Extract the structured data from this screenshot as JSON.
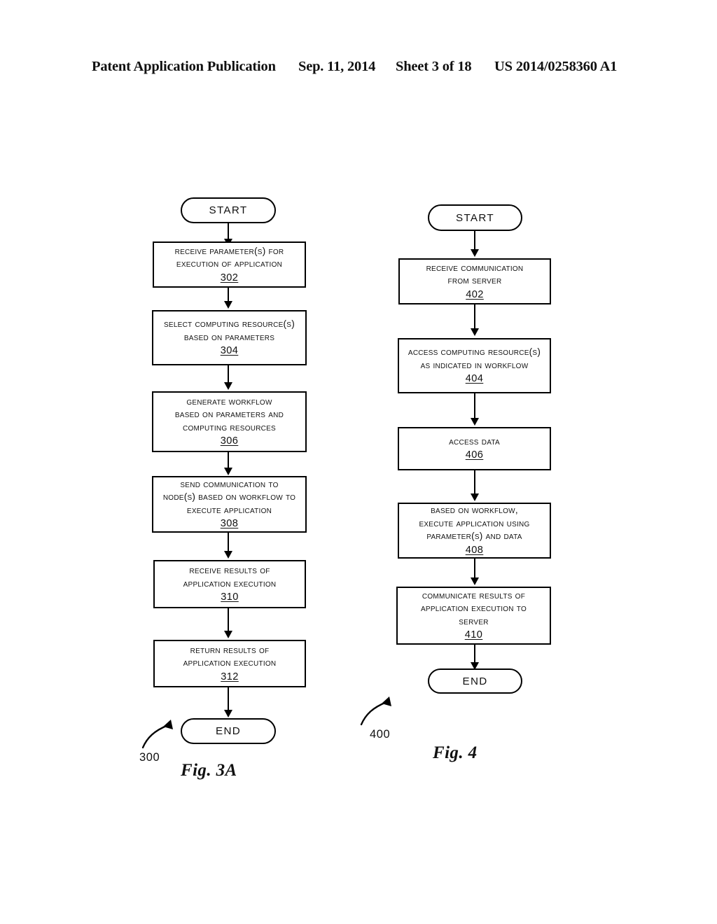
{
  "header": {
    "publication": "Patent Application Publication",
    "date": "Sep. 11, 2014",
    "sheet": "Sheet 3 of 18",
    "patent_number": "US 2014/0258360 A1"
  },
  "figures": [
    {
      "id": "fig-3a",
      "caption": "Fig. 3A",
      "lead_number": "300",
      "start_label": "START",
      "end_label": "END",
      "steps": [
        {
          "ref": "302",
          "lines": [
            "RECEIVE PARAMETER(S) FOR",
            "EXECUTION OF APPLICATION"
          ]
        },
        {
          "ref": "304",
          "lines": [
            "SELECT COMPUTING RESOURCE(S)",
            "BASED ON PARAMETERS"
          ]
        },
        {
          "ref": "306",
          "lines": [
            "GENERATE WORKFLOW",
            "BASED ON PARAMETERS AND",
            "COMPUTING RESOURCES"
          ]
        },
        {
          "ref": "308",
          "lines": [
            "SEND COMMUNICATION TO",
            "NODE(S) BASED ON WORKFLOW TO",
            "EXECUTE APPLICATION"
          ]
        },
        {
          "ref": "310",
          "lines": [
            "RECEIVE RESULTS OF",
            "APPLICATION EXECUTION"
          ]
        },
        {
          "ref": "312",
          "lines": [
            "RETURN RESULTS OF",
            "APPLICATION EXECUTION"
          ]
        }
      ]
    },
    {
      "id": "fig-4",
      "caption": "Fig. 4",
      "lead_number": "400",
      "start_label": "START",
      "end_label": "END",
      "steps": [
        {
          "ref": "402",
          "lines": [
            "RECEIVE COMMUNICATION",
            "FROM SERVER"
          ]
        },
        {
          "ref": "404",
          "lines": [
            "ACCESS COMPUTING RESOURCE(S)",
            "AS INDICATED IN WORKFLOW"
          ]
        },
        {
          "ref": "406",
          "lines": [
            "ACCESS DATA"
          ]
        },
        {
          "ref": "408",
          "lines": [
            "BASED ON WORKFLOW,",
            "EXECUTE APPLICATION USING",
            "PARAMETER(S) AND DATA"
          ]
        },
        {
          "ref": "410",
          "lines": [
            "COMMUNICATE RESULTS OF",
            "APPLICATION EXECUTION TO",
            "SERVER"
          ]
        }
      ]
    }
  ],
  "colors": {
    "ink": "#000000",
    "paper": "#ffffff"
  }
}
